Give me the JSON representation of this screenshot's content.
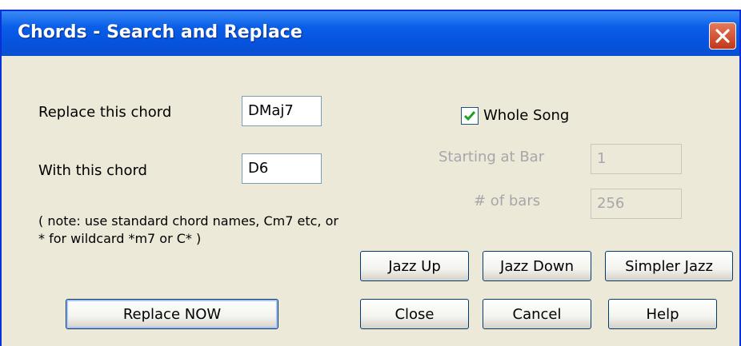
{
  "window": {
    "title": "Chords - Search and Replace"
  },
  "form": {
    "replace_label": "Replace this chord",
    "replace_value": "DMaj7",
    "with_label": "With this chord",
    "with_value": "D6",
    "note_line1": "( note: use standard chord names, Cm7 etc, or",
    "note_line2": "* for wildcard *m7 or C* )"
  },
  "scope": {
    "whole_song_label": "Whole Song",
    "whole_song_checked": true,
    "starting_bar_label": "Starting at Bar",
    "starting_bar_value": "1",
    "num_bars_label": "# of bars",
    "num_bars_value": "256"
  },
  "buttons": {
    "jazz_up": "Jazz Up",
    "jazz_down": "Jazz Down",
    "simpler_jazz": "Simpler Jazz",
    "replace_now": "Replace NOW",
    "close": "Close",
    "cancel": "Cancel",
    "help": "Help"
  },
  "colors": {
    "titlebar": "#0a5ee8",
    "dialog_bg": "#ece9d8",
    "check": "#21a121",
    "disabled_text": "#a7a6aa"
  }
}
